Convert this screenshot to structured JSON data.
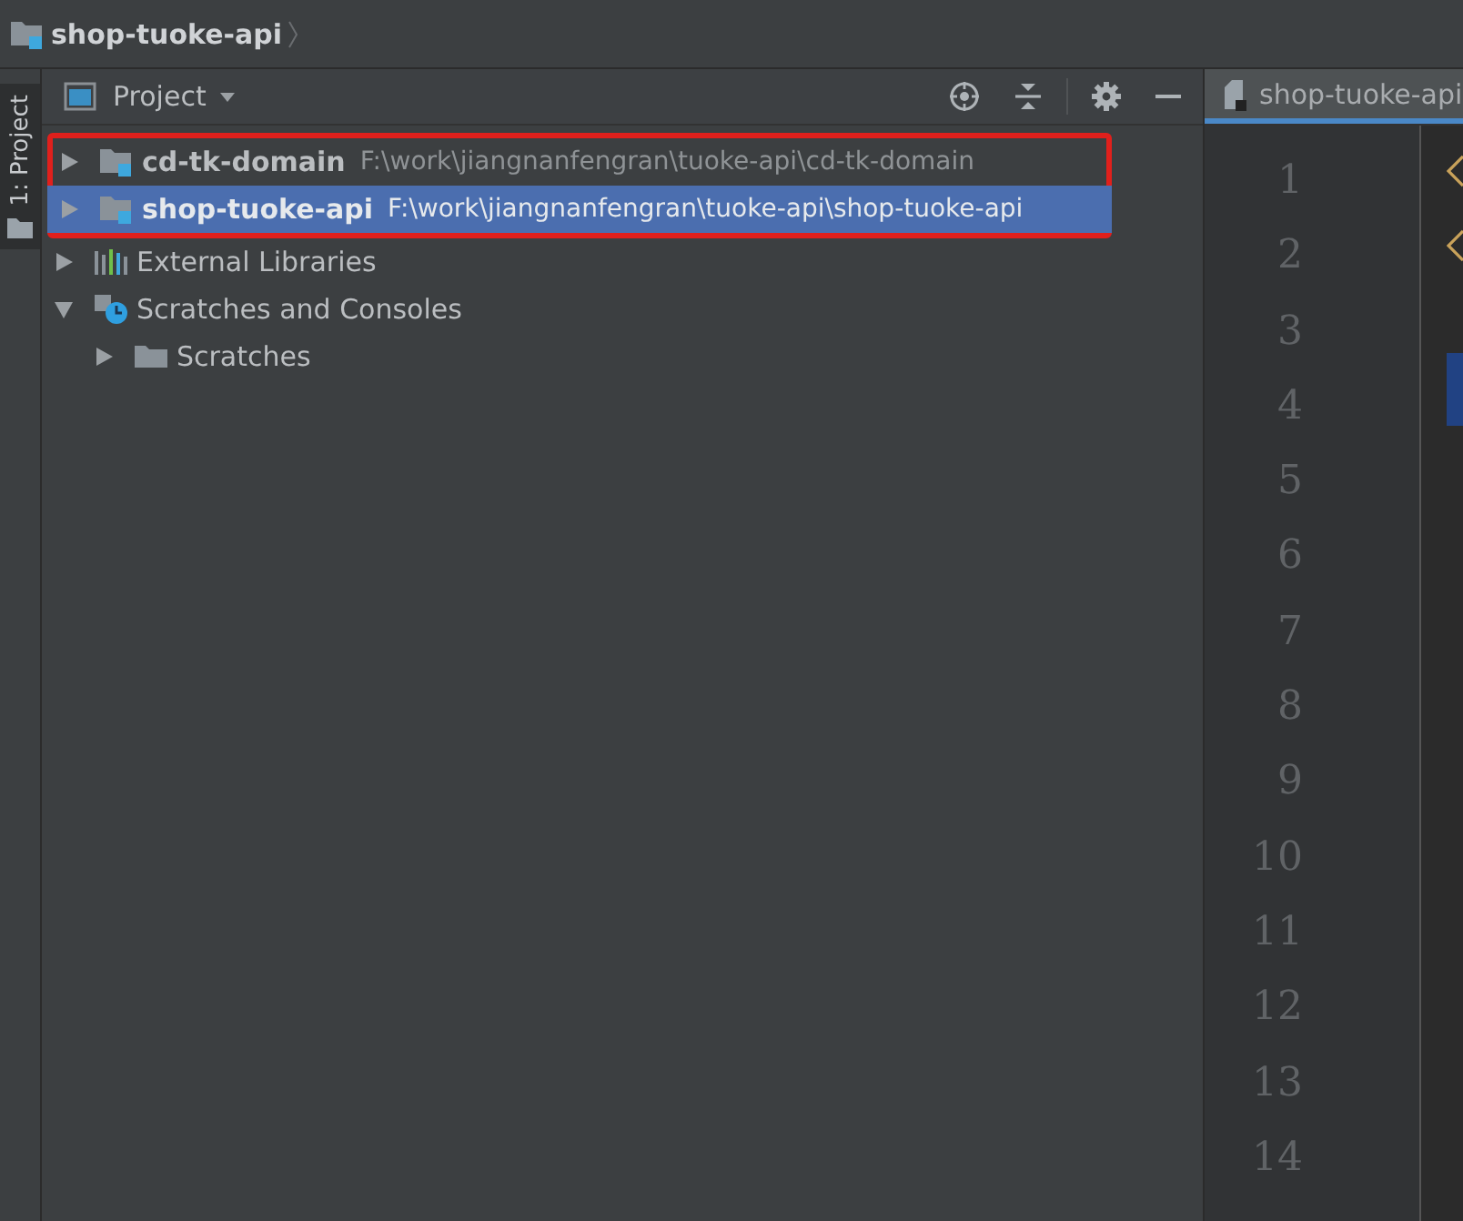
{
  "breadcrumb": {
    "title": "shop-tuoke-api"
  },
  "side_tab": {
    "label": "1: Project",
    "selected": true
  },
  "project_panel": {
    "title": "Project",
    "tree": [
      {
        "kind": "module",
        "label": "cd-tk-domain",
        "path": "F:\\work\\jiangnanfengran\\tuoke-api\\cd-tk-domain",
        "expanded": false,
        "selected": false,
        "highlighted": true
      },
      {
        "kind": "module",
        "label": "shop-tuoke-api",
        "path": "F:\\work\\jiangnanfengran\\tuoke-api\\shop-tuoke-api",
        "expanded": false,
        "selected": true,
        "highlighted": true
      },
      {
        "kind": "libraries",
        "label": "External Libraries",
        "expanded": false,
        "selected": false,
        "highlighted": false
      },
      {
        "kind": "scratches",
        "label": "Scratches and Consoles",
        "expanded": true,
        "selected": false,
        "highlighted": false,
        "children": [
          {
            "kind": "folder",
            "label": "Scratches",
            "expanded": false,
            "selected": false,
            "highlighted": false
          }
        ]
      }
    ]
  },
  "editor": {
    "tab": {
      "label": "shop-tuoke-api",
      "selected": true
    },
    "line_numbers": [
      "1",
      "2",
      "3",
      "4",
      "5",
      "6",
      "7",
      "8",
      "9",
      "10",
      "11",
      "12",
      "13",
      "14"
    ]
  }
}
